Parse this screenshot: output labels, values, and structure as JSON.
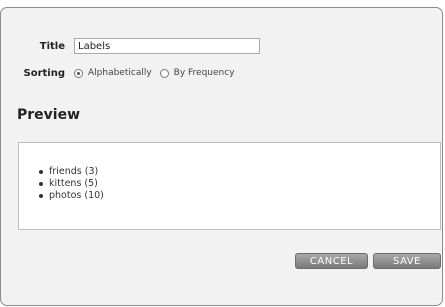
{
  "form": {
    "title_label": "Title",
    "title_value": "Labels",
    "sorting_label": "Sorting",
    "sorting_options": [
      {
        "label": "Alphabetically",
        "selected": true
      },
      {
        "label": "By Frequency",
        "selected": false
      }
    ]
  },
  "preview": {
    "heading": "Preview",
    "items": [
      "friends (3)",
      "kittens (5)",
      "photos (10)"
    ]
  },
  "buttons": {
    "cancel_label": "CANCEL",
    "save_label": "SAVE"
  }
}
